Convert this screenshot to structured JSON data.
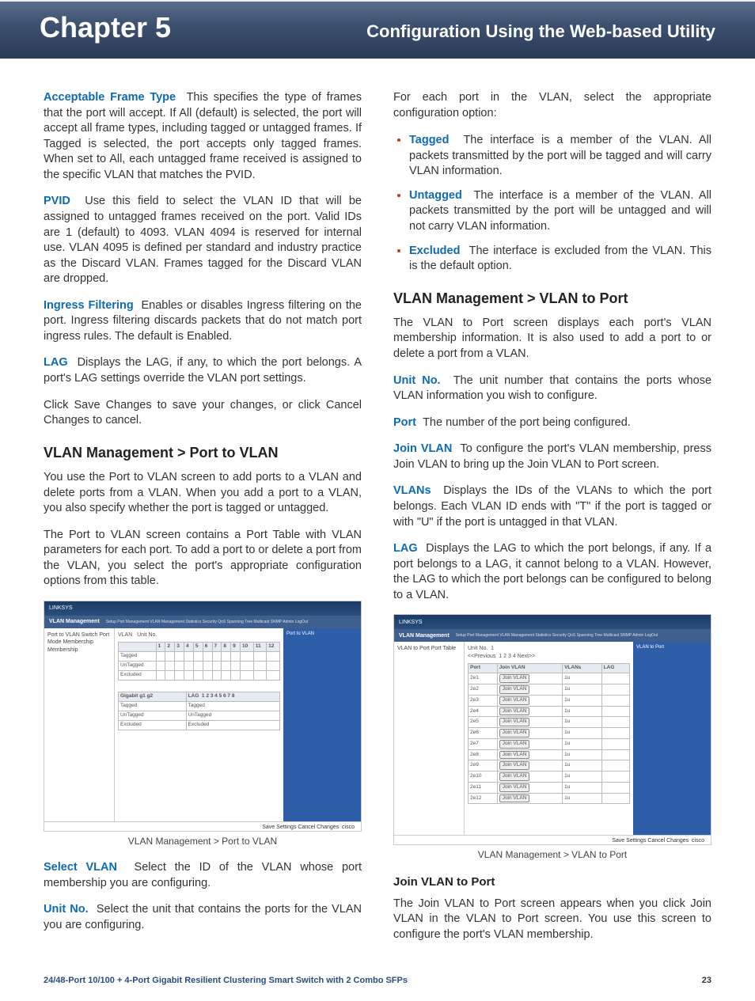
{
  "banner": {
    "chapter": "Chapter 5",
    "title": "Configuration Using the Web-based Utility"
  },
  "left": {
    "aft": {
      "label": "Acceptable Frame Type",
      "text": "This specifies the type of frames that the port will accept. If All (default) is selected, the port will accept all frame types, including tagged or untagged frames. If Tagged is selected, the port accepts only tagged frames. When set to All, each untagged frame received is assigned to the specific VLAN that matches the PVID."
    },
    "pvid": {
      "label": "PVID",
      "text": "Use this field to select the VLAN ID that will be assigned to untagged frames received on the port. Valid IDs are 1 (default) to 4093. VLAN 4094 is reserved for internal use. VLAN 4095 is defined per standard and industry practice as the Discard VLAN. Frames tagged for the Discard VLAN are dropped."
    },
    "ingress": {
      "label": "Ingress Filtering",
      "text": "Enables or disables Ingress filtering on the port. Ingress filtering discards packets that do not match port ingress rules. The default is Enabled."
    },
    "lag": {
      "label": "LAG",
      "text": "Displays the LAG, if any, to which the port belongs. A port's LAG settings override the VLAN port settings."
    },
    "save": "Click Save Changes to save your changes, or click Cancel Changes to cancel.",
    "h_ptov": "VLAN Management > Port to VLAN",
    "ptov_p1": "You use the Port to VLAN screen to add ports to a VLAN and delete ports from a VLAN. When you add a port to a VLAN, you also specify whether the port is tagged or untagged.",
    "ptov_p2": "The Port to VLAN screen contains a Port Table with VLAN parameters for each port. To add a port to or delete a port from the VLAN, you select the port's appropriate configuration options from this table.",
    "fig1_caption": "VLAN Management > Port to VLAN",
    "selectvlan": {
      "label": "Select VLAN",
      "text": "Select the ID of the VLAN whose port membership you are configuring."
    },
    "unitno": {
      "label": "Unit No.",
      "text": "Select the unit that contains the ports for the VLAN you are configuring."
    }
  },
  "right": {
    "intro": "For each port in the VLAN, select the appropriate configuration option:",
    "opts": {
      "tagged": {
        "label": "Tagged",
        "text": "The interface is a member of the VLAN. All packets transmitted by the port will be tagged and will carry VLAN information."
      },
      "untagged": {
        "label": "Untagged",
        "text": "The interface is a member of the VLAN. All packets transmitted by the port will be untagged and will not carry VLAN information."
      },
      "excluded": {
        "label": "Excluded",
        "text": "The interface is excluded from the VLAN. This is the default option."
      }
    },
    "h_vtop": "VLAN Management > VLAN to Port",
    "vtop_p1": "The VLAN to Port screen displays each port's VLAN membership information. It is also used to add a port to or delete a port from a VLAN.",
    "unitno": {
      "label": "Unit No.",
      "text": "The unit number that contains the ports whose VLAN information you wish to configure."
    },
    "port": {
      "label": "Port",
      "text": "The number of the port being configured."
    },
    "joinvlan": {
      "label": "Join VLAN",
      "text": "To configure the port's VLAN membership, press Join VLAN to bring up the Join VLAN to Port screen."
    },
    "vlans": {
      "label": "VLANs",
      "text": "Displays the IDs of the VLANs to which the port belongs. Each VLAN ID ends with \"T\" if the port is tagged or with \"U\" if the port is untagged in that VLAN."
    },
    "lag": {
      "label": "LAG",
      "text": "Displays the LAG to which the port belongs, if any. If a port belongs to a LAG, it cannot belong to a VLAN. However, the LAG to which the port belongs can be configured to belong to a VLAN."
    },
    "fig2_caption": "VLAN Management > VLAN to Port",
    "h_join": "Join VLAN to Port",
    "join_p": "The Join VLAN to Port screen appears when you click Join VLAN in the VLAN to Port screen. You use this screen to configure the port's VLAN membership."
  },
  "fig": {
    "brand": "LINKSYS",
    "heading": "VLAN Management",
    "tabs": "Setup   Port Management   VLAN Management   Statistics   Security   QoS   Spanning Tree   Multicast   SNMP   Admin   LogOut",
    "side1": "Port to VLAN\nSwitch Port Mode\n\nMembership\n\nMembership",
    "side2": "VLAN to Port\nPort Table",
    "save": "Save Settings  Cancel Changes",
    "cisco": "cisco",
    "help1": "Port to VLAN",
    "help2": "VLAN to Port"
  },
  "footer": {
    "title": "24/48-Port 10/100 + 4-Port Gigabit Resilient Clustering Smart Switch with 2 Combo SFPs",
    "page": "23"
  }
}
